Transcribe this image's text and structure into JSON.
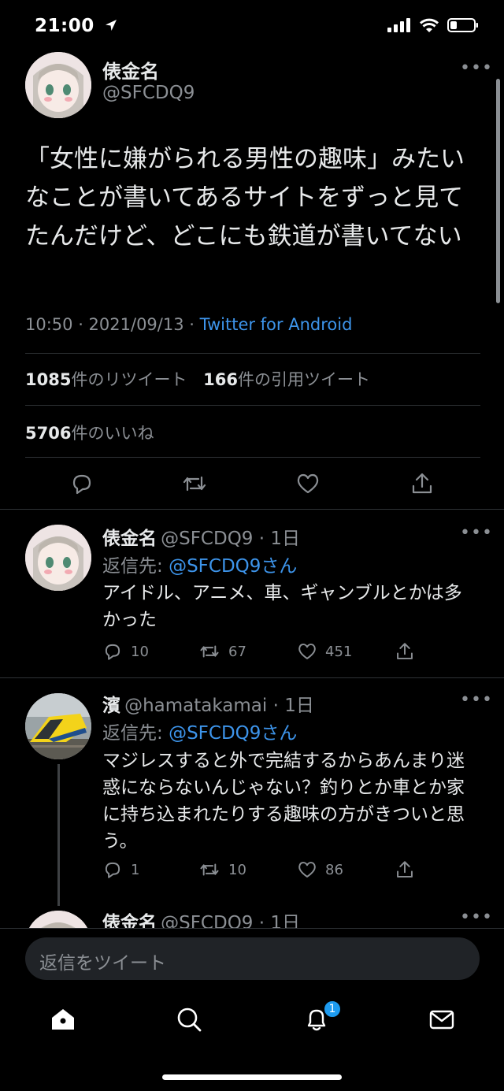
{
  "status_bar": {
    "time": "21:00"
  },
  "main_tweet": {
    "name": "俵金名",
    "handle": "@SFCDQ9",
    "text": "「女性に嫌がられる男性の趣味」みたいなことが書いてあるサイトをずっと見てたんだけど、どこにも鉄道が書いてない",
    "timestamp": "10:50 · 2021/09/13 · ",
    "source": "Twitter for Android",
    "retweets_count": "1085",
    "retweets_label": "件のリツイート",
    "quotes_count": "166",
    "quotes_label": "件の引用ツイート",
    "likes_count": "5706",
    "likes_label": "件のいいね"
  },
  "replies": [
    {
      "name": "俵金名",
      "handle_time": "@SFCDQ9 · 1日",
      "reply_to_label": "返信先: ",
      "reply_to_handle": "@SFCDQ9さん",
      "text": "アイドル、アニメ、車、ギャンブルとかは多かった",
      "reply_count": "10",
      "retweet_count": "67",
      "like_count": "451"
    },
    {
      "name": "濱",
      "handle_time": "@hamatakamai · 1日",
      "reply_to_label": "返信先: ",
      "reply_to_handle": "@SFCDQ9さん",
      "text": "マジレスすると外で完結するからあんまり迷惑にならないんじゃない？釣りとか車とか家に持ち込まれたりする趣味の方がきついと思う。",
      "reply_count": "1",
      "retweet_count": "10",
      "like_count": "86"
    },
    {
      "name": "俵金名",
      "handle_time": "@SFCDQ9 · 1日"
    }
  ],
  "compose": {
    "placeholder": "返信をツイート"
  },
  "tab_bar": {
    "notifications_badge": "1"
  },
  "colors": {
    "background": "#000000",
    "accent": "#1d9bf0",
    "link": "#3d94ea",
    "muted": "#8b8f94",
    "divider": "#2f3336"
  }
}
